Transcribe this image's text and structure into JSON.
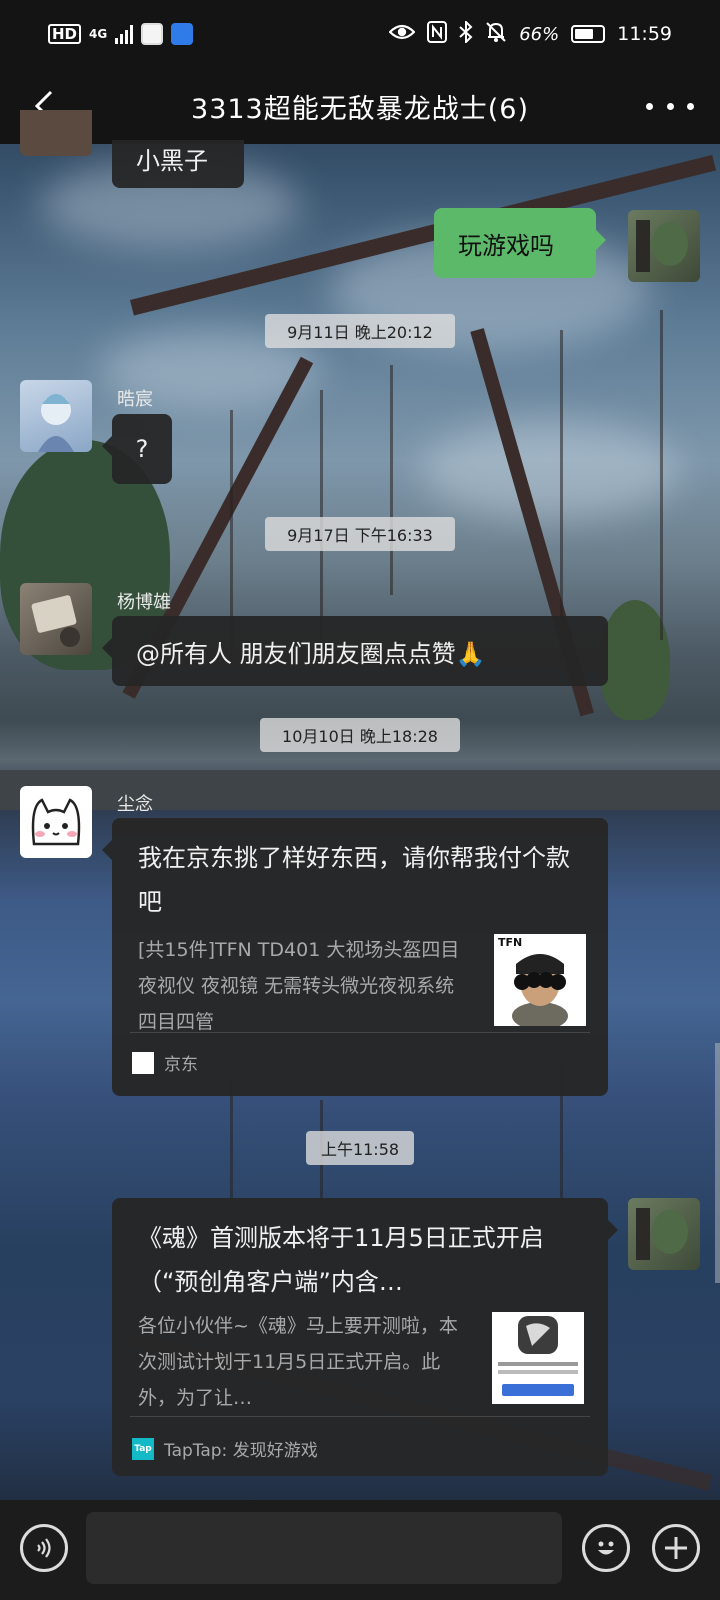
{
  "status_bar": {
    "hd": "HD",
    "network": "4G",
    "battery": "66%",
    "time": "11:59"
  },
  "header": {
    "title": "3313超能无敌暴龙战士(6)"
  },
  "messages": {
    "m0_text": "小黑子",
    "m1_text": "玩游戏吗",
    "ts1": "9月11日 晚上20:12",
    "m2_sender": "晧宸",
    "m2_text": "?",
    "ts2": "9月17日 下午16:33",
    "m3_sender": "杨博雄",
    "m3_text": "@所有人  朋友们朋友圈点点赞🙏",
    "ts3": "10月10日 晚上18:28",
    "m4_sender": "尘念",
    "m4_title": "我在京东挑了样好东西，请你帮我付个款吧",
    "m4_desc": "[共15件]TFN TD401 大视场头盔四目夜视仪 夜视镜 无需转头微光夜视系统 四目四管",
    "m4_thumb_label": "TFN",
    "m4_source": "京东",
    "ts4": "上午11:58",
    "m5_title": "《魂》首测版本将于11月5日正式开启（“预创角客户端”内含…",
    "m5_desc": "各位小伙伴~《魂》马上要开测啦，本次测试计划于11月5日正式开启。此外，为了让…",
    "m5_source": "TapTap: 发现好游戏",
    "m5_source_icon": "Tap"
  },
  "colors": {
    "green_bubble": "#5cb96a",
    "bubble_dark": "#262626",
    "bar": "#141414"
  },
  "input": {
    "placeholder": ""
  }
}
